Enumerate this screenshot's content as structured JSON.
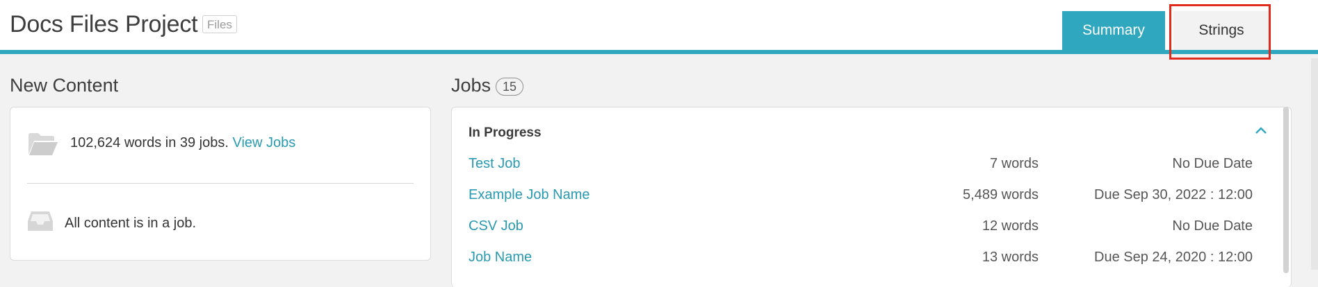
{
  "header": {
    "title": "Docs Files Project",
    "badge": "Files",
    "tabs": [
      {
        "label": "Summary",
        "active": true
      },
      {
        "label": "Strings",
        "active": false
      }
    ]
  },
  "new_content": {
    "title": "New Content",
    "summary_text": "102,624 words in 39 jobs.",
    "view_jobs_link": "View Jobs",
    "status_text": "All content is in a job."
  },
  "jobs": {
    "title": "Jobs",
    "count": "15",
    "groups": [
      {
        "title": "In Progress",
        "rows": [
          {
            "name": "Test Job",
            "words": "7 words",
            "due": "No Due Date"
          },
          {
            "name": "Example Job Name",
            "words": "5,489 words",
            "due": "Due Sep 30, 2022 : 12:00"
          },
          {
            "name": "CSV Job",
            "words": "12 words",
            "due": "No Due Date"
          },
          {
            "name": "Job Name",
            "words": "13 words",
            "due": "Due Sep 24, 2020 : 12:00"
          }
        ]
      }
    ]
  },
  "colors": {
    "accent": "#2ea7bf",
    "link": "#2799b0",
    "highlight": "#e02a1e",
    "background": "#f2f2f2"
  },
  "icons": [
    "folder-open-icon",
    "inbox-tray-icon",
    "chevron-up-icon"
  ]
}
